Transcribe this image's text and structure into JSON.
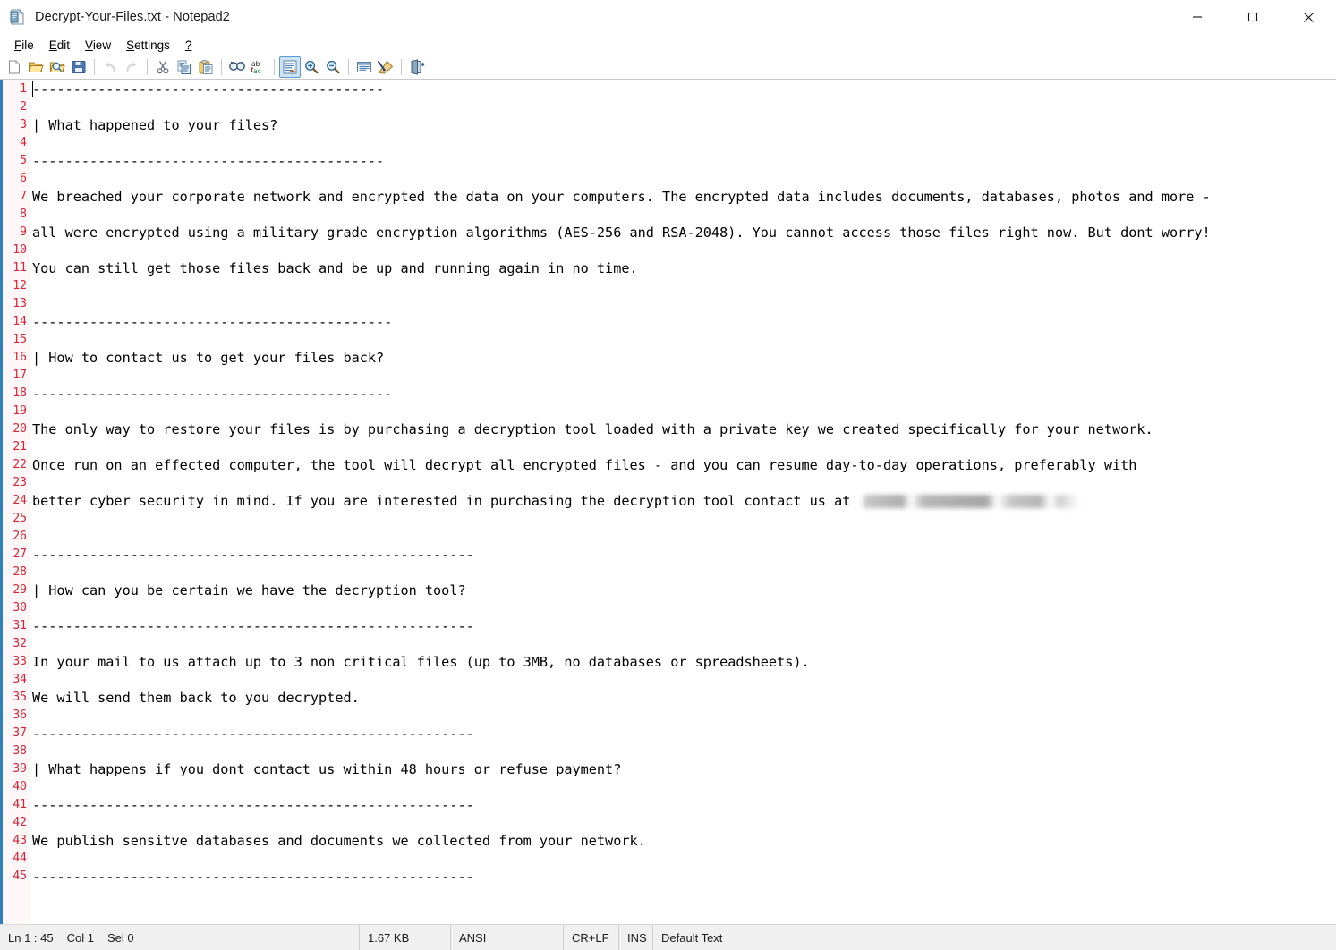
{
  "window": {
    "title": "Decrypt-Your-Files.txt - Notepad2",
    "icon": "notepad2-document-icon",
    "minimize_label": "—",
    "maximize_label": "☐",
    "close_label": "✕"
  },
  "menubar": {
    "items": [
      {
        "label": "File",
        "accel": "F"
      },
      {
        "label": "Edit",
        "accel": "E"
      },
      {
        "label": "View",
        "accel": "V"
      },
      {
        "label": "Settings",
        "accel": "S"
      },
      {
        "label": "?",
        "accel": "?"
      }
    ]
  },
  "toolbar": {
    "buttons": [
      {
        "name": "new-file-icon",
        "tip": "New",
        "state": "normal"
      },
      {
        "name": "open-file-icon",
        "tip": "Open",
        "state": "normal"
      },
      {
        "name": "browse-file-icon",
        "tip": "Browse",
        "state": "normal"
      },
      {
        "name": "save-file-icon",
        "tip": "Save",
        "state": "normal"
      },
      {
        "name": "separator",
        "tip": "",
        "state": "sep"
      },
      {
        "name": "undo-icon",
        "tip": "Undo",
        "state": "disabled"
      },
      {
        "name": "redo-icon",
        "tip": "Redo",
        "state": "disabled"
      },
      {
        "name": "separator",
        "tip": "",
        "state": "sep"
      },
      {
        "name": "cut-icon",
        "tip": "Cut",
        "state": "normal"
      },
      {
        "name": "copy-icon",
        "tip": "Copy",
        "state": "normal"
      },
      {
        "name": "paste-icon",
        "tip": "Paste",
        "state": "normal"
      },
      {
        "name": "separator",
        "tip": "",
        "state": "sep"
      },
      {
        "name": "find-icon",
        "tip": "Find",
        "state": "normal"
      },
      {
        "name": "replace-icon",
        "tip": "Replace",
        "state": "normal"
      },
      {
        "name": "separator",
        "tip": "",
        "state": "sep"
      },
      {
        "name": "word-wrap-icon",
        "tip": "Word Wrap",
        "state": "active"
      },
      {
        "name": "zoom-in-icon",
        "tip": "Zoom In",
        "state": "normal"
      },
      {
        "name": "zoom-out-icon",
        "tip": "Zoom Out",
        "state": "normal"
      },
      {
        "name": "separator",
        "tip": "",
        "state": "sep"
      },
      {
        "name": "scheme-icon",
        "tip": "Scheme",
        "state": "normal"
      },
      {
        "name": "scheme-options-icon",
        "tip": "Scheme Options",
        "state": "normal"
      },
      {
        "name": "separator",
        "tip": "",
        "state": "sep"
      },
      {
        "name": "exit-icon",
        "tip": "Exit",
        "state": "normal"
      }
    ]
  },
  "editor": {
    "caret_visible": true,
    "first_line": 1,
    "lines": [
      {
        "n": 1,
        "text": "-------------------------------------------"
      },
      {
        "n": 2,
        "text": ""
      },
      {
        "n": 3,
        "text": "| What happened to your files?"
      },
      {
        "n": 4,
        "text": ""
      },
      {
        "n": 5,
        "text": "-------------------------------------------"
      },
      {
        "n": 6,
        "text": ""
      },
      {
        "n": 7,
        "text": "We breached your corporate network and encrypted the data on your computers. The encrypted data includes documents, databases, photos and more -"
      },
      {
        "n": 8,
        "text": ""
      },
      {
        "n": 9,
        "text": "all were encrypted using a military grade encryption algorithms (AES-256 and RSA-2048). You cannot access those files right now. But dont worry!"
      },
      {
        "n": 10,
        "text": ""
      },
      {
        "n": 11,
        "text": "You can still get those files back and be up and running again in no time."
      },
      {
        "n": 12,
        "text": ""
      },
      {
        "n": 13,
        "text": ""
      },
      {
        "n": 14,
        "text": "--------------------------------------------"
      },
      {
        "n": 15,
        "text": ""
      },
      {
        "n": 16,
        "text": "| How to contact us to get your files back?"
      },
      {
        "n": 17,
        "text": ""
      },
      {
        "n": 18,
        "text": "--------------------------------------------"
      },
      {
        "n": 19,
        "text": ""
      },
      {
        "n": 20,
        "text": "The only way to restore your files is by purchasing a decryption tool loaded with a private key we created specifically for your network."
      },
      {
        "n": 21,
        "text": ""
      },
      {
        "n": 22,
        "text": "Once run on an effected computer, the tool will decrypt all encrypted files - and you can resume day-to-day operations, preferably with"
      },
      {
        "n": 23,
        "text": ""
      },
      {
        "n": 24,
        "text": "better cyber security in mind. If you are interested in purchasing the decryption tool contact us at ",
        "redacted": true
      },
      {
        "n": 25,
        "text": ""
      },
      {
        "n": 26,
        "text": ""
      },
      {
        "n": 27,
        "text": "------------------------------------------------------"
      },
      {
        "n": 28,
        "text": ""
      },
      {
        "n": 29,
        "text": "| How can you be certain we have the decryption tool?"
      },
      {
        "n": 30,
        "text": ""
      },
      {
        "n": 31,
        "text": "------------------------------------------------------"
      },
      {
        "n": 32,
        "text": ""
      },
      {
        "n": 33,
        "text": "In your mail to us attach up to 3 non critical files (up to 3MB, no databases or spreadsheets)."
      },
      {
        "n": 34,
        "text": ""
      },
      {
        "n": 35,
        "text": "We will send them back to you decrypted."
      },
      {
        "n": 36,
        "text": ""
      },
      {
        "n": 37,
        "text": "------------------------------------------------------"
      },
      {
        "n": 38,
        "text": ""
      },
      {
        "n": 39,
        "text": "| What happens if you dont contact us within 48 hours or refuse payment?"
      },
      {
        "n": 40,
        "text": ""
      },
      {
        "n": 41,
        "text": "------------------------------------------------------"
      },
      {
        "n": 42,
        "text": ""
      },
      {
        "n": 43,
        "text": "We publish sensitve databases and documents we collected from your network."
      },
      {
        "n": 44,
        "text": ""
      },
      {
        "n": 45,
        "text": "------------------------------------------------------"
      }
    ]
  },
  "statusbar": {
    "line": "Ln 1 : 45",
    "column": "Col 1",
    "selection": "Sel 0",
    "filesize": "1.67 KB",
    "encoding": "ANSI",
    "line_endings": "CR+LF",
    "insert_mode": "INS",
    "scheme": "Default Text"
  },
  "colors": {
    "line_number": "#d62436",
    "accent_border": "#2f7fb8",
    "text": "#000000",
    "gutter_bg": "#fdf7f7",
    "statusbar_bg": "#f0f0f0"
  }
}
